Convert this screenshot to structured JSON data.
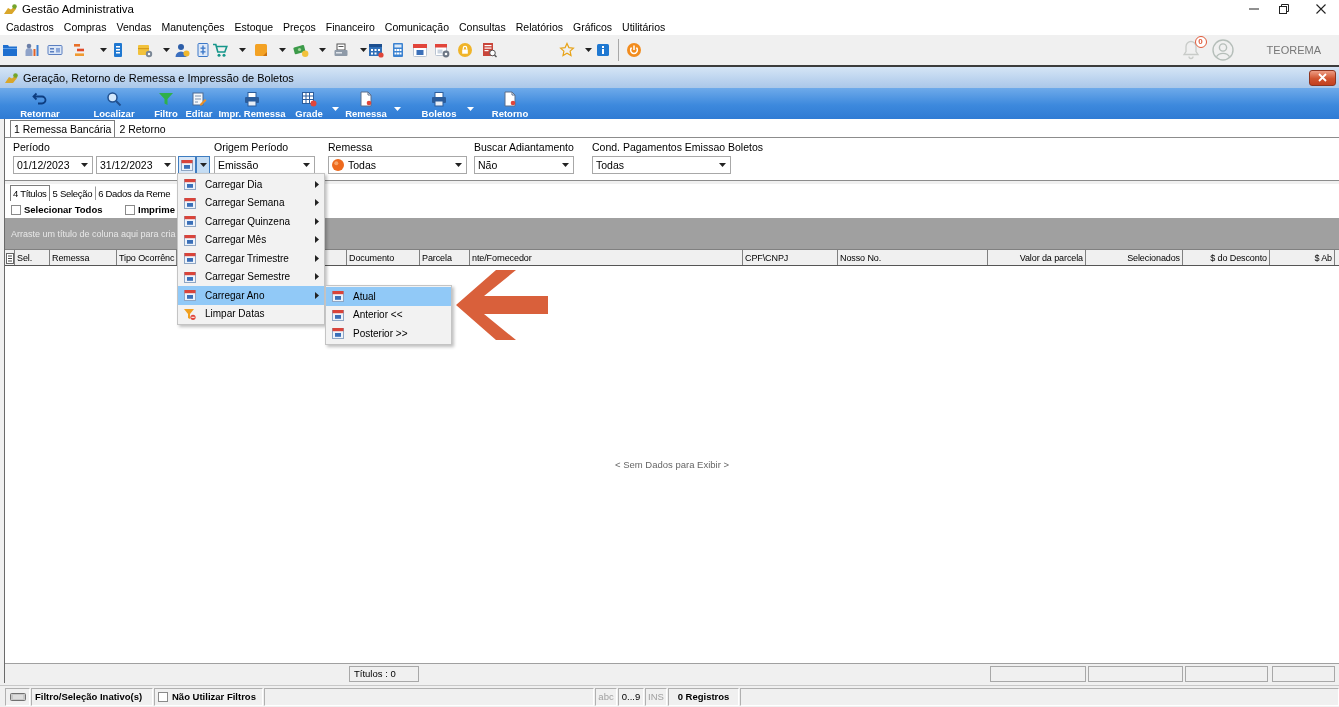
{
  "window": {
    "title": "Gestão Administrativa"
  },
  "menu_bar": [
    "Cadastros",
    "Compras",
    "Vendas",
    "Manutenções",
    "Estoque",
    "Preços",
    "Financeiro",
    "Comunicação",
    "Consultas",
    "Relatórios",
    "Gráficos",
    "Utilitários"
  ],
  "toolbar": {
    "notifications": "0",
    "user": "TEOREMA"
  },
  "document_window": {
    "title": "Geração, Retorno de Remessa e Impressão de Boletos",
    "actions": [
      {
        "label": "Retornar",
        "dropdown": false
      },
      {
        "label": "Localizar",
        "dropdown": false
      },
      {
        "label": "Filtro",
        "dropdown": false
      },
      {
        "label": "Editar",
        "dropdown": false
      },
      {
        "label": "Impr. Remessa",
        "dropdown": false
      },
      {
        "label": "Grade",
        "dropdown": true
      },
      {
        "label": "Remessa",
        "dropdown": true
      },
      {
        "label": "Boletos",
        "dropdown": true
      },
      {
        "label": "Retorno",
        "dropdown": false
      }
    ],
    "tabs": [
      {
        "label": "1 Remessa Bancária",
        "selected": true
      },
      {
        "label": "2 Retorno",
        "selected": false
      }
    ],
    "filters": {
      "period": {
        "label": "Período",
        "start": "01/12/2023",
        "end": "31/12/2023"
      },
      "origin": {
        "label": "Origem Período",
        "value": "Emissão"
      },
      "remessa": {
        "label": "Remessa",
        "value": "Todas"
      },
      "advance": {
        "label": "Buscar Adiantamento",
        "value": "Não"
      },
      "payment_terms": {
        "label": "Cond. Pagamentos Emissao Boletos",
        "value": "Todas"
      }
    },
    "date_menu": {
      "open": true,
      "items": [
        {
          "label": "Carregar Dia",
          "kind": "period",
          "has_submenu": true,
          "selected": false
        },
        {
          "label": "Carregar Semana",
          "kind": "period",
          "has_submenu": true,
          "selected": false
        },
        {
          "label": "Carregar Quinzena",
          "kind": "period",
          "has_submenu": true,
          "selected": false
        },
        {
          "label": "Carregar Mês",
          "kind": "period",
          "has_submenu": true,
          "selected": false
        },
        {
          "label": "Carregar Trimestre",
          "kind": "period",
          "has_submenu": true,
          "selected": false
        },
        {
          "label": "Carregar Semestre",
          "kind": "period",
          "has_submenu": true,
          "selected": false
        },
        {
          "label": "Carregar Ano",
          "kind": "period",
          "has_submenu": true,
          "selected": true
        },
        {
          "label": "Limpar Datas",
          "kind": "clear",
          "has_submenu": false,
          "selected": false
        }
      ],
      "submenu_items": [
        {
          "label": "Atual",
          "selected": true
        },
        {
          "label": "Anterior <<",
          "selected": false
        },
        {
          "label": "Posterior >>",
          "selected": false
        }
      ]
    },
    "sub_tabs": [
      {
        "label": "4 Títulos",
        "selected": true
      },
      {
        "label": "5 Seleção",
        "selected": false
      },
      {
        "label": "6 Dados da Reme",
        "selected": false
      }
    ],
    "options": [
      {
        "label": "Selecionar Todos",
        "checked": false
      },
      {
        "label": "Imprime",
        "checked": false
      }
    ],
    "grid": {
      "group_hint": "Arraste um título de coluna aqui para cria",
      "columns": [
        {
          "label": "Sel.",
          "kind": "text"
        },
        {
          "label": "Remessa",
          "kind": "text"
        },
        {
          "label": "Tipo Ocorrênc",
          "kind": "text"
        },
        {
          "label": "Documento",
          "kind": "text"
        },
        {
          "label": "Parcela",
          "kind": "text"
        },
        {
          "label": "nte/Fornecedor",
          "kind": "text"
        },
        {
          "label": "CPF\\CNPJ",
          "kind": "text"
        },
        {
          "label": "Nosso No.",
          "kind": "text"
        },
        {
          "label": "Valor da parcela",
          "kind": "amount"
        },
        {
          "label": "Selecionados",
          "kind": "amount"
        },
        {
          "label": "$ do Desconto",
          "kind": "amount"
        },
        {
          "label": "$ Ab",
          "kind": "amount"
        }
      ],
      "empty_text": "< Sem Dados para Exibir >",
      "footer": "Títulos : 0"
    }
  },
  "status_bar": {
    "filter_state": "Filtro/Seleção Inativo(s)",
    "no_filters": {
      "label": "Não Utilizar Filtros",
      "checked": false
    },
    "indicators": [
      {
        "label": "abc",
        "disabled": true
      },
      {
        "label": "0...9",
        "disabled": false
      },
      {
        "label": "INS",
        "disabled": true
      }
    ],
    "records": "0 Registros"
  }
}
